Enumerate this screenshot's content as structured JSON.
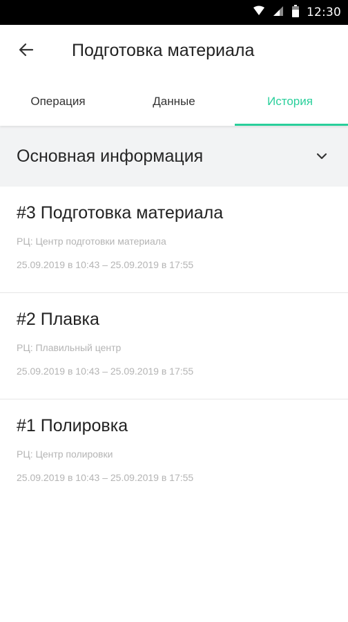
{
  "status_bar": {
    "time": "12:30",
    "icons": [
      "wifi-icon",
      "signal-icon",
      "battery-icon"
    ]
  },
  "app_bar": {
    "back_icon": "arrow-left-icon",
    "title": "Подготовка материала"
  },
  "tabs": [
    {
      "label": "Операция",
      "active": false
    },
    {
      "label": "Данные",
      "active": false
    },
    {
      "label": "История",
      "active": true
    }
  ],
  "section": {
    "title": "Основная информация",
    "icon": "chevron-down-icon"
  },
  "history": [
    {
      "title": "#3 Подготовка материала",
      "center": "РЦ: Центр подготовки материала",
      "dates": "25.09.2019 в 10:43 – 25.09.2019 в 17:55"
    },
    {
      "title": "#2 Плавка",
      "center": "РЦ: Плавильный центр",
      "dates": "25.09.2019 в 10:43 – 25.09.2019 в 17:55"
    },
    {
      "title": "#1 Полировка",
      "center": "РЦ: Центр полировки",
      "dates": "25.09.2019 в 10:43 – 25.09.2019 в 17:55"
    }
  ],
  "colors": {
    "accent": "#29cf9b",
    "section_background": "#f2f3f4",
    "secondary_text": "#b4b4b4",
    "status_bar": "#000000"
  }
}
